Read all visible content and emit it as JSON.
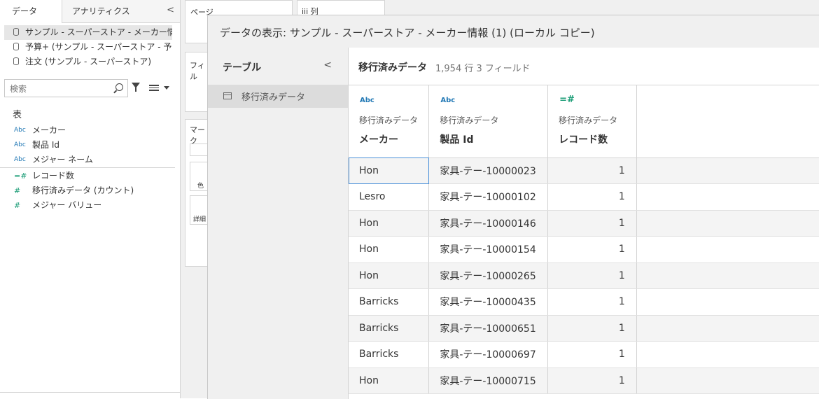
{
  "left_pane": {
    "tabs": [
      "データ",
      "アナリティクス"
    ],
    "collapse_glyph": "<",
    "data_sources": [
      "サンプル - スーパーストア - メーカー情報 …",
      "予算+ (サンプル - スーパーストア - 予…",
      "注文 (サンプル - スーパーストア)"
    ],
    "search_placeholder": "検索",
    "section_title": "表",
    "dimensions": [
      {
        "type": "Abc",
        "name": "メーカー"
      },
      {
        "type": "Abc",
        "name": "製品 Id"
      },
      {
        "type": "Abc",
        "name": "メジャー ネーム"
      }
    ],
    "measures": [
      {
        "type": "=#",
        "name": "レコード数"
      },
      {
        "type": "#",
        "name": "移行済みデータ (カウント)"
      },
      {
        "type": "#",
        "name": "メジャー バリュー"
      }
    ]
  },
  "shelves": {
    "pages_label": "ページ",
    "columns_label": "iii 列",
    "filters_label": "フィル",
    "marks_label": "マーク",
    "color_label": "色",
    "detail_label": "詳細"
  },
  "dialog": {
    "title": "データの表示: サンプル - スーパーストア - メーカー情報 (1) (ローカル コピー)",
    "tables_header": "テーブル",
    "tables_collapse": "<",
    "tables": [
      "移行済みデータ"
    ],
    "current_table": "移行済みデータ",
    "meta": "1,954 行 3 フィールド",
    "columns": [
      {
        "type": "Abc",
        "source": "移行済みデータ",
        "name": "メーカー"
      },
      {
        "type": "=#",
        "source": "移行済みデータ",
        "name": "製品 Id"
      },
      {
        "type": "=#",
        "source": "移行済みデータ",
        "name": "レコード数"
      }
    ],
    "rows": [
      [
        "Hon",
        "家具-テー-10000023",
        "1"
      ],
      [
        "Lesro",
        "家具-テー-10000102",
        "1"
      ],
      [
        "Hon",
        "家具-テー-10000146",
        "1"
      ],
      [
        "Hon",
        "家具-テー-10000154",
        "1"
      ],
      [
        "Hon",
        "家具-テー-10000265",
        "1"
      ],
      [
        "Barricks",
        "家具-テー-10000435",
        "1"
      ],
      [
        "Barricks",
        "家具-テー-10000651",
        "1"
      ],
      [
        "Barricks",
        "家具-テー-10000697",
        "1"
      ],
      [
        "Hon",
        "家具-テー-10000715",
        "1"
      ]
    ]
  }
}
